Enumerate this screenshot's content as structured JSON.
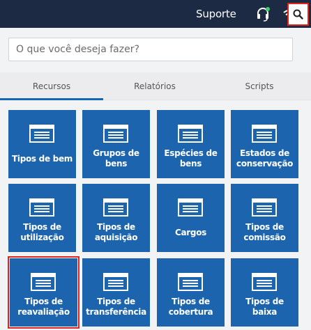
{
  "header": {
    "support_label": "Suporte",
    "icons": [
      "headset-icon",
      "wifi-icon",
      "search-icon"
    ],
    "status_color": "#3bd16f"
  },
  "search": {
    "placeholder": "O que você deseja fazer?"
  },
  "tabs": [
    {
      "label": "Recursos",
      "active": true
    },
    {
      "label": "Relatórios",
      "active": false
    },
    {
      "label": "Scripts",
      "active": false
    }
  ],
  "tiles": [
    {
      "label": "Tipos de bem"
    },
    {
      "label": "Grupos de bens"
    },
    {
      "label": "Espécies de bens"
    },
    {
      "label": "Estados de conservação"
    },
    {
      "label": "Tipos de utilização"
    },
    {
      "label": "Tipos de aquisição"
    },
    {
      "label": "Cargos"
    },
    {
      "label": "Tipos de comissão"
    },
    {
      "label": "Tipos de reavaliação",
      "highlighted": true
    },
    {
      "label": "Tipos de transferência"
    },
    {
      "label": "Tipos de cobertura"
    },
    {
      "label": "Tipos de baixa"
    }
  ],
  "colors": {
    "header_bg": "#1d2a44",
    "tile_bg": "#1c64ad",
    "accent": "#1565b5",
    "highlight": "#e2231a"
  }
}
